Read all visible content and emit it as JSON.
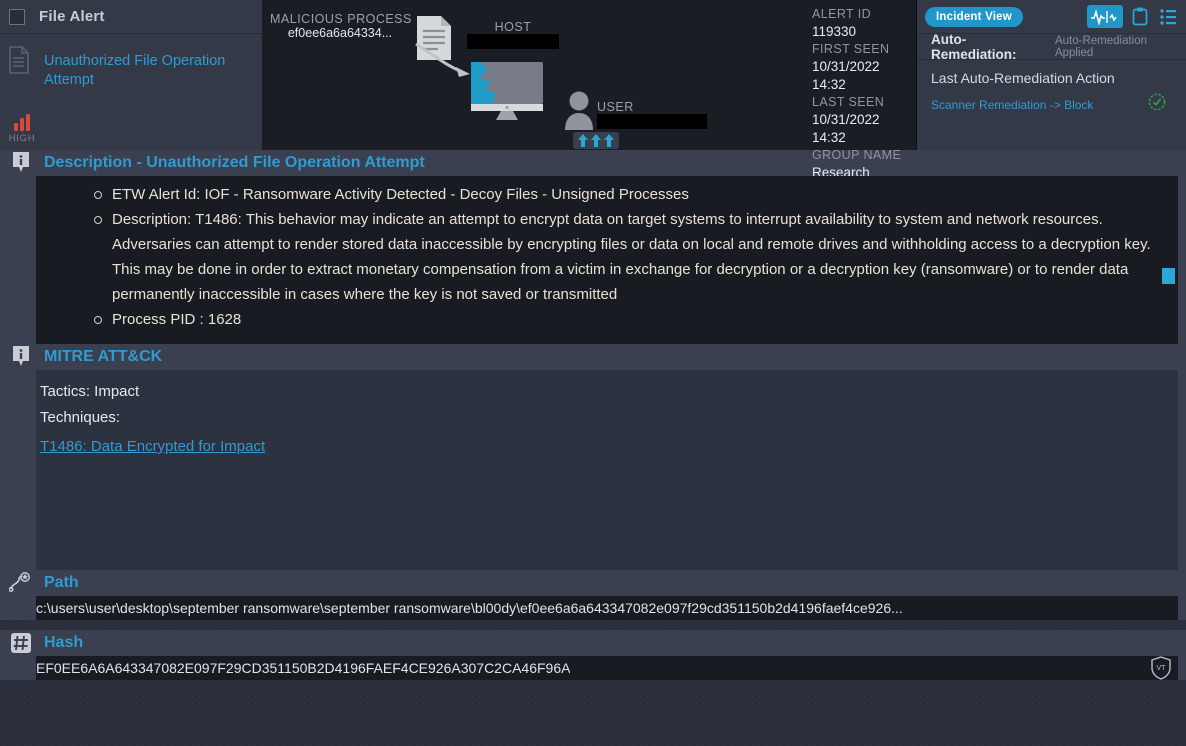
{
  "alert_card": {
    "title": "File Alert",
    "checkbox_checked": false,
    "doc_icon": "document-icon",
    "link_text": "Unauthorized File Operation Attempt",
    "severity_label": "HIGH",
    "severity_color": "#d94a3d"
  },
  "graph": {
    "malicious_process_label": "MALICIOUS PROCESS",
    "malicious_process_value": "ef0ee6a6a64334...",
    "host_label": "HOST",
    "host_value_redacted": "███████████",
    "user_label": "USER",
    "user_value_redacted": "█████████████",
    "file_icon": "file-document-icon",
    "arrow_icon": "arrow-right-curved-icon",
    "monitor_icon": "desktop-monitor-icon",
    "user_icon": "person-avatar-icon",
    "escalation_icon": "triple-up-arrows-icon"
  },
  "meta": {
    "alert_id_label": "ALERT ID",
    "alert_id_value": "119330",
    "first_seen_label": "FIRST SEEN",
    "first_seen_value": "10/31/2022 14:32",
    "last_seen_label": "LAST SEEN",
    "last_seen_value": "10/31/2022 14:32",
    "group_name_label": "GROUP NAME",
    "group_name_value": "Research"
  },
  "remediation": {
    "incident_view_label": "Incident View",
    "accent_color": "#2196c8",
    "icons": [
      {
        "name": "activity-pulse-dropdown-icon"
      },
      {
        "name": "clipboard-icon"
      },
      {
        "name": "checklist-icon"
      }
    ],
    "auto_remediation_label": "Auto-Remediation:",
    "auto_remediation_status": "Auto-Remediation Applied",
    "last_action_heading": "Last Auto-Remediation Action",
    "last_action_value": "Scanner Remediation -> Block",
    "status_icon": "check-circle-icon",
    "status_color": "#2f9e4f"
  },
  "description_section": {
    "icon": "info-bubble-icon",
    "title": "Description - Unauthorized File Operation Attempt",
    "bullets": [
      "ETW Alert Id: IOF - Ransomware Activity Detected - Decoy Files - Unsigned Processes",
      "Description: T1486: This behavior may indicate an attempt to encrypt data on target systems to interrupt availability to system and network resources. Adversaries can attempt to render stored data inaccessible by encrypting files or data on local and remote drives and withholding access to a decryption key. This may be done in order to extract monetary compensation from a victim in exchange for decryption or a decryption key (ransomware) or to render data permanently inaccessible in cases where the key is not saved or transmitted",
      "Process PID : 1628"
    ],
    "scrollbar_color": "#29a8d8"
  },
  "mitre_section": {
    "icon": "info-bubble-icon",
    "title": "MITRE ATT&CK",
    "tactics_line": "Tactics: Impact",
    "techniques_line": "Techniques:",
    "technique_link": "T1486: Data Encrypted for Impact"
  },
  "path_section": {
    "icon": "path-route-icon",
    "title": "Path",
    "value": "c:\\users\\user\\desktop\\september ransomware\\september ransomware\\bl00dy\\ef0ee6a6a643347082e097f29cd351150b2d4196faef4ce926..."
  },
  "hash_section": {
    "icon": "hash-icon",
    "title": "Hash",
    "value": "EF0EE6A6A643347082E097F29CD351150B2D4196FAEF4CE926A307C2CA46F96A",
    "vt_badge": "virustotal-shield-icon",
    "vt_label": "VT"
  }
}
